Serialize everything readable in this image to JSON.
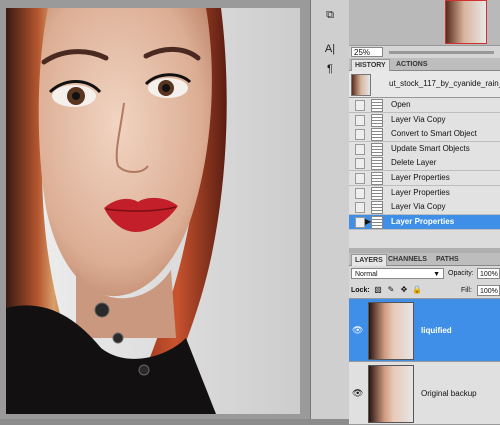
{
  "navigator": {
    "zoom": "25%"
  },
  "toolstrip": {
    "tools": [
      {
        "name": "history-brush-icon",
        "glyph": "⧉"
      },
      {
        "name": "character-icon",
        "glyph": "A|"
      },
      {
        "name": "paragraph-icon",
        "glyph": "¶"
      }
    ]
  },
  "history": {
    "tabs": [
      "HISTORY",
      "ACTIONS"
    ],
    "snapshot": "ut_stock_117_by_cyanide_rain_st",
    "items": [
      "Open",
      "Layer Via Copy",
      "Convert to Smart Object",
      "Update Smart Objects",
      "Delete Layer",
      "Layer Properties",
      "Layer Properties",
      "Layer Via Copy",
      "Layer Properties"
    ],
    "active_index": 8
  },
  "layers": {
    "tabs": [
      "LAYERS",
      "CHANNELS",
      "PATHS"
    ],
    "blend_mode": "Normal",
    "opacity_label": "Opacity:",
    "opacity": "100%",
    "lock_label": "Lock:",
    "fill_label": "Fill:",
    "fill": "100%",
    "items": [
      {
        "name": "liquified",
        "active": true
      },
      {
        "name": "Original backup",
        "active": false
      }
    ]
  },
  "colors": {
    "selection": "#3f8fe8",
    "panel_bg": "#dcdcdc"
  }
}
